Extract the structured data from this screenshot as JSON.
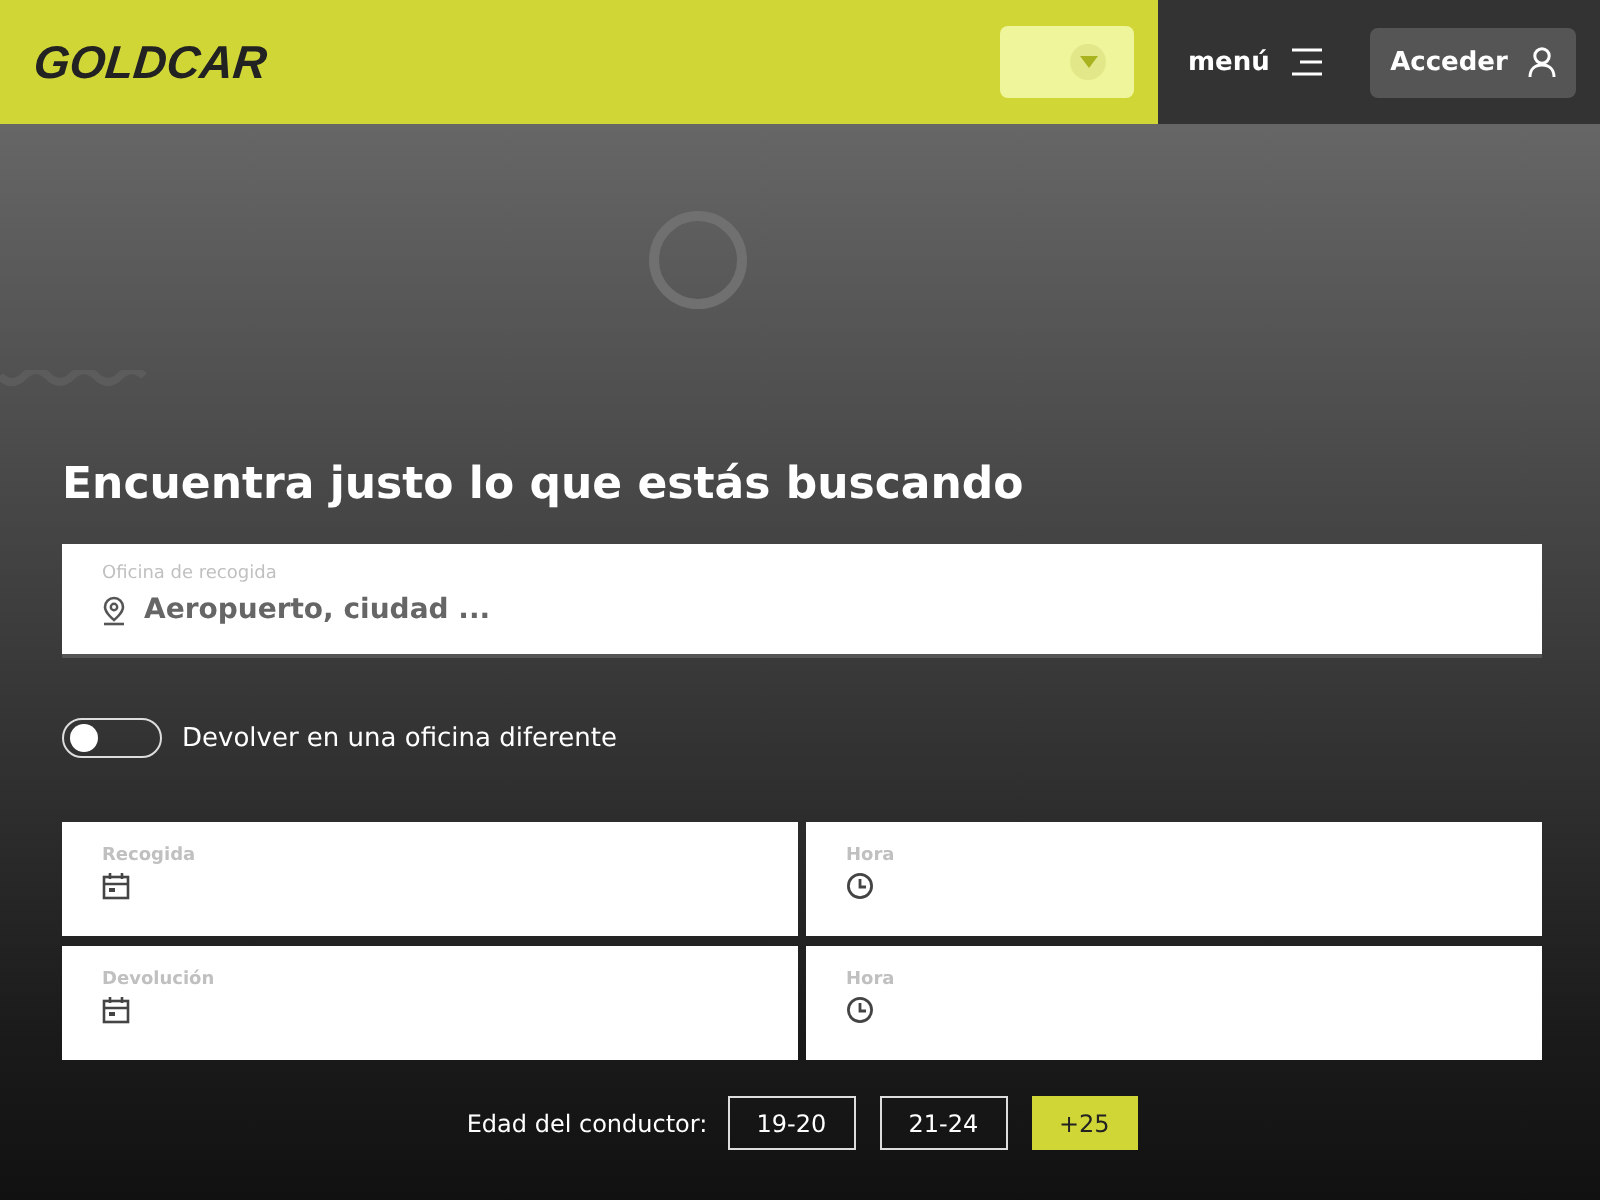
{
  "header": {
    "logo": "GOLDCAR",
    "menu_label": "menú",
    "login_button": "Acceder"
  },
  "title": "Encuentra justo lo que estás buscando",
  "pickup_office": {
    "label": "Oficina de recogida",
    "placeholder": "Aeropuerto, ciudad ..."
  },
  "return_toggle": {
    "label": "Devolver en una oficina diferente",
    "on": false
  },
  "date_fields": [
    {
      "label": "Recogida",
      "kind": "date"
    },
    {
      "label": "Hora",
      "kind": "time"
    },
    {
      "label": "Devolución",
      "kind": "date"
    },
    {
      "label": "Hora",
      "kind": "time"
    }
  ],
  "driver_age": {
    "label": "Edad del conductor:",
    "options": [
      {
        "label": "19-20",
        "selected": false
      },
      {
        "label": "21-24",
        "selected": false
      },
      {
        "label": "+25",
        "selected": true
      }
    ]
  }
}
